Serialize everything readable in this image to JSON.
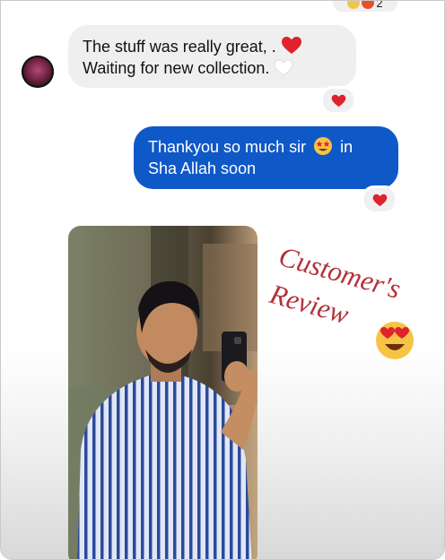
{
  "messages": [
    {
      "sender": "them",
      "line1": "The stuff was really great, .",
      "line2": "Waiting for new collection.",
      "reaction": "heart"
    },
    {
      "sender": "me",
      "line1": "Thankyou so much sir",
      "line1_end": "in",
      "line2": "Sha Allah soon",
      "reaction": "heart"
    }
  ],
  "top_reaction": {
    "count": "2"
  },
  "sticker": {
    "word1": "Customer's",
    "word2": "Review",
    "emoji": "heart-eyes"
  },
  "colors": {
    "bubble_in": "#efefef",
    "bubble_out": "#0f58c8",
    "heart": "#e0222f",
    "sticker_text": "#b2323a"
  }
}
